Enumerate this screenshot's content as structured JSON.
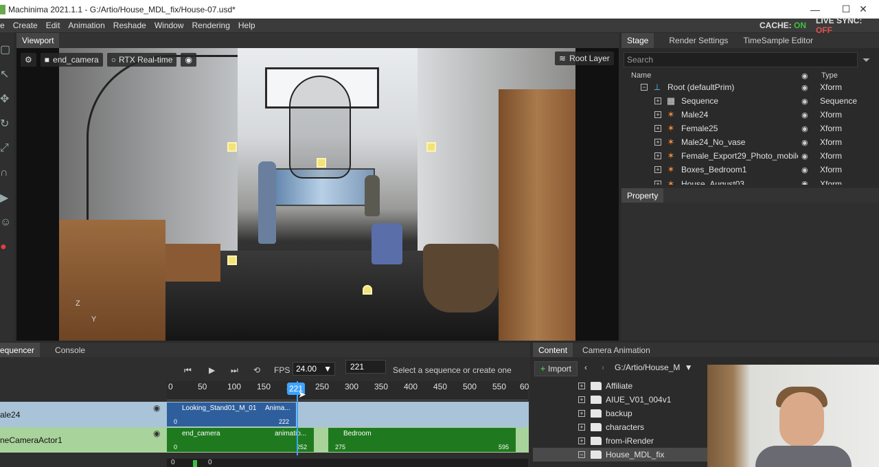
{
  "window": {
    "title": "Machinima 2021.1.1 - G:/Artio/House_MDL_fix/House-07.usd*",
    "minimize": "—",
    "maximize": "☐",
    "close": "✕"
  },
  "menu": [
    "Create",
    "Edit",
    "Animation",
    "Reshade",
    "Window",
    "Rendering",
    "Help"
  ],
  "menu_partial": "e",
  "status": {
    "cache_label": "CACHE:",
    "cache_value": "ON",
    "live_sync_label": "LIVE SYNC:",
    "live_sync_value": "OFF"
  },
  "viewport": {
    "tab": "Viewport",
    "camera": "end_camera",
    "renderer": "RTX Real-time",
    "layer": "Root Layer",
    "axis_z": "Z",
    "axis_y": "Y"
  },
  "stage": {
    "tabs": [
      "Stage",
      "Render Settings",
      "TimeSample Editor"
    ],
    "search_placeholder": "Search",
    "col_name": "Name",
    "col_type": "Type",
    "rows": [
      {
        "name": "Root (defaultPrim)",
        "type": "Xform",
        "icon": "prim-icon",
        "exp": "−"
      },
      {
        "name": "Sequence",
        "type": "Sequence",
        "icon": "clapper-icon",
        "exp": "+"
      },
      {
        "name": "Male24",
        "type": "Xform",
        "icon": "character-icon",
        "exp": "+"
      },
      {
        "name": "Female25",
        "type": "Xform",
        "icon": "character-icon",
        "exp": "+"
      },
      {
        "name": "Male24_No_vase",
        "type": "Xform",
        "icon": "character-icon",
        "exp": "+"
      },
      {
        "name": "Female_Export29_Photo_mobile",
        "type": "Xform",
        "icon": "character-icon",
        "exp": "+"
      },
      {
        "name": "Boxes_Bedroom1",
        "type": "Xform",
        "icon": "character-icon",
        "exp": "+"
      },
      {
        "name": "House_August03",
        "type": "Xform",
        "icon": "character-icon",
        "exp": "+"
      }
    ]
  },
  "property": {
    "tab": "Property"
  },
  "sequencer": {
    "tabs": [
      "equencer",
      "Console"
    ],
    "fps_label": "FPS",
    "fps_value": "24.00",
    "frame": "221",
    "message": "Select a sequence or create one",
    "ticks": [
      "0",
      "50",
      "100",
      "150",
      "200",
      "250",
      "300",
      "350",
      "400",
      "450",
      "500",
      "550",
      "60"
    ],
    "playhead": "221",
    "tracks": [
      {
        "label": "ale24",
        "clips": [
          {
            "title": "Looking_Stand01_M_01",
            "sub": "Anima...",
            "start": "0",
            "end": "222"
          }
        ]
      },
      {
        "label": "neCameraActor1",
        "clips": [
          {
            "title": "end_camera",
            "sub": "animatio...",
            "start": "0",
            "end": "252"
          },
          {
            "title": "Bedroom",
            "sub": "",
            "start": "275",
            "end": "595"
          }
        ]
      }
    ],
    "bottom_a": "0",
    "bottom_b": "0"
  },
  "content": {
    "tabs": [
      "Content",
      "Camera Animation"
    ],
    "import": "Import",
    "path": "G:/Artio/House_M",
    "folders": [
      "Affiliate",
      "AIUE_V01_004v1",
      "backup",
      "characters",
      "from-iRender",
      "House_MDL_fix"
    ]
  }
}
